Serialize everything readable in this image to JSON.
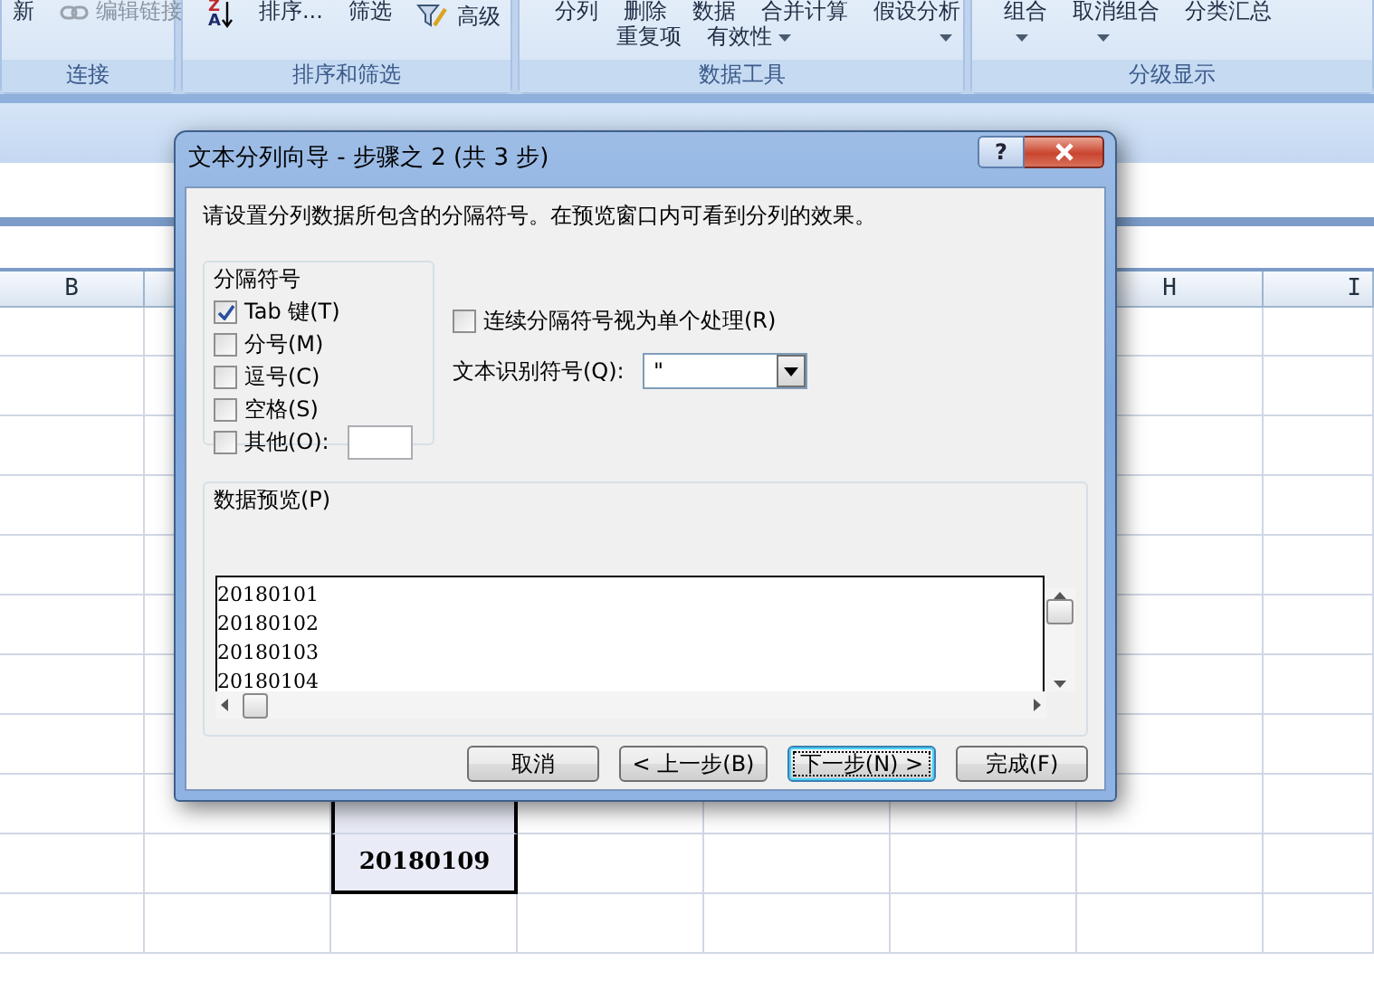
{
  "ribbon": {
    "groups": [
      {
        "label": "连接",
        "upper": [
          {
            "kind": "text",
            "text": "新",
            "disabled": false
          },
          {
            "kind": "link",
            "text": "编辑链接",
            "disabled": true
          }
        ]
      },
      {
        "label": "排序和筛选",
        "upper": [
          {
            "kind": "sort",
            "letters": [
              "Z",
              "A"
            ]
          },
          {
            "kind": "text",
            "text": "排序...",
            "disabled": false
          },
          {
            "kind": "text",
            "text": "筛选",
            "disabled": false
          },
          {
            "kind": "filter",
            "text": "高级",
            "disabled": false
          }
        ]
      },
      {
        "label": "数据工具",
        "upper": [
          {
            "kind": "text",
            "text": "分列",
            "disabled": false
          },
          {
            "kind": "text",
            "text": "删除",
            "disabled": false
          },
          {
            "kind": "text",
            "text": "数据",
            "disabled": false
          },
          {
            "kind": "text",
            "text": "合并计算",
            "disabled": false
          },
          {
            "kind": "text",
            "text": "假设分析",
            "disabled": false
          }
        ],
        "lower": [
          {
            "kind": "text",
            "text": "重复项",
            "disabled": false
          },
          {
            "kind": "dropdown",
            "text": "有效性",
            "disabled": false
          },
          {
            "kind": "caret"
          }
        ]
      },
      {
        "label": "分级显示",
        "upper": [
          {
            "kind": "text",
            "text": "组合",
            "disabled": false
          },
          {
            "kind": "text",
            "text": "取消组合",
            "disabled": false
          },
          {
            "kind": "text",
            "text": "分类汇总",
            "disabled": false
          }
        ],
        "lower": [
          {
            "kind": "caret"
          },
          {
            "kind": "caret"
          }
        ]
      }
    ]
  },
  "sheet": {
    "column_headers": [
      "B",
      "H",
      "I"
    ],
    "selected_cells": [
      "20180109"
    ]
  },
  "dialog": {
    "title": "文本分列向导 - 步骤之 2 (共 3 步)",
    "help": "?",
    "instruction": "请设置分列数据所包含的分隔符号。在预览窗口内可看到分列的效果。",
    "delimiters": {
      "legend": "分隔符号",
      "options": [
        {
          "label": "Tab 键(T)",
          "checked": true
        },
        {
          "label": "分号(M)",
          "checked": false
        },
        {
          "label": "逗号(C)",
          "checked": false
        },
        {
          "label": "空格(S)",
          "checked": false
        },
        {
          "label": "其他(O):",
          "checked": false,
          "kind": "other"
        }
      ]
    },
    "consecutive": {
      "label": "连续分隔符号视为单个处理(R)",
      "checked": false
    },
    "qualifier": {
      "label": "文本识别符号(Q):",
      "value": "\""
    },
    "preview": {
      "legend": "数据预览(P)",
      "lines": [
        "20180101",
        "20180102",
        "20180103",
        "20180104"
      ]
    },
    "buttons": [
      {
        "label": "取消",
        "focused": false
      },
      {
        "label": "< 上一步(B)",
        "focused": false
      },
      {
        "label": "下一步(N) >",
        "focused": true
      },
      {
        "label": "完成(F)",
        "focused": false
      }
    ]
  }
}
